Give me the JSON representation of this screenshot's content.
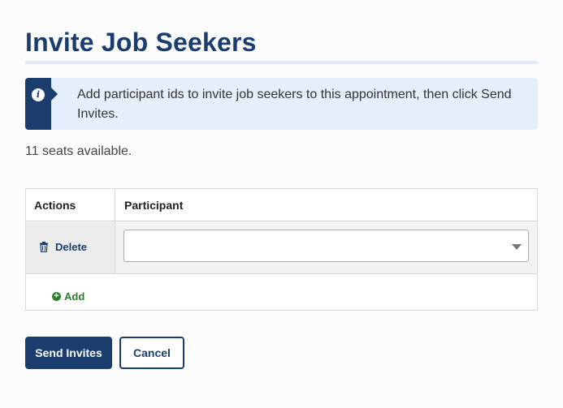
{
  "page": {
    "title": "Invite Job Seekers"
  },
  "info": {
    "icon": "info-icon",
    "text": "Add participant ids to invite job seekers to this appointment, then click Send Invites."
  },
  "seats": {
    "text": "11 seats available."
  },
  "table": {
    "headers": [
      "Actions",
      "Participant"
    ],
    "rows": [
      {
        "delete_label": "Delete",
        "delete_icon": "trash-icon",
        "participant_value": ""
      }
    ],
    "add_label": "Add",
    "add_icon": "plus-circle-icon"
  },
  "buttons": {
    "send_label": "Send Invites",
    "cancel_label": "Cancel"
  },
  "colors": {
    "primary": "#1b3d6e",
    "info_background": "#e4effb",
    "add_green": "#2e7d32"
  }
}
